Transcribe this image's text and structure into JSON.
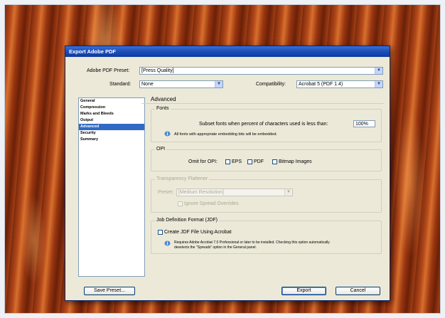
{
  "dialog": {
    "title": "Export Adobe PDF",
    "preset_label": "Adobe PDF Preset:",
    "preset_value": "[Press Quality]",
    "standard_label": "Standard:",
    "standard_value": "None",
    "compat_label": "Compatibility:",
    "compat_value": "Acrobat 5 (PDF 1.4)"
  },
  "sidebar": {
    "items": [
      {
        "label": "General"
      },
      {
        "label": "Compression"
      },
      {
        "label": "Marks and Bleeds"
      },
      {
        "label": "Output"
      },
      {
        "label": "Advanced",
        "selected": true
      },
      {
        "label": "Security"
      },
      {
        "label": "Summary"
      }
    ]
  },
  "panel": {
    "title": "Advanced",
    "fonts": {
      "title": "Fonts",
      "subset_label": "Subset fonts when percent of characters used is less than:",
      "subset_value": "100%",
      "note": "All fonts with appropriate embedding bits will be embedded."
    },
    "opi": {
      "title": "OPI",
      "omit_label": "Omit for OPI:",
      "eps": "EPS",
      "pdf": "PDF",
      "bitmap": "Bitmap Images"
    },
    "flattener": {
      "title": "Transparency Flattener",
      "preset_label": "Preset:",
      "preset_value": "[Medium Resolution]",
      "ignore_label": "Ignore Spread Overrides"
    },
    "jdf": {
      "title": "Job Definition Format (JDF)",
      "create_label": "Create JDF File Using Acrobat",
      "note_line1": "Requires Adobe Acrobat 7.0 Professional or later to be installed. Checking this option automatically",
      "note_line2": "deselects the \"Spreads\" option in the General panel."
    }
  },
  "buttons": {
    "save_preset": "Save Preset...",
    "export": "Export",
    "cancel": "Cancel"
  },
  "icons": {
    "dropdown": "chevron-down-icon",
    "info": "info-icon"
  },
  "colors": {
    "titlebar": "#1c4db8",
    "selection": "#316ac5",
    "dialog_bg": "#ece9d8"
  }
}
